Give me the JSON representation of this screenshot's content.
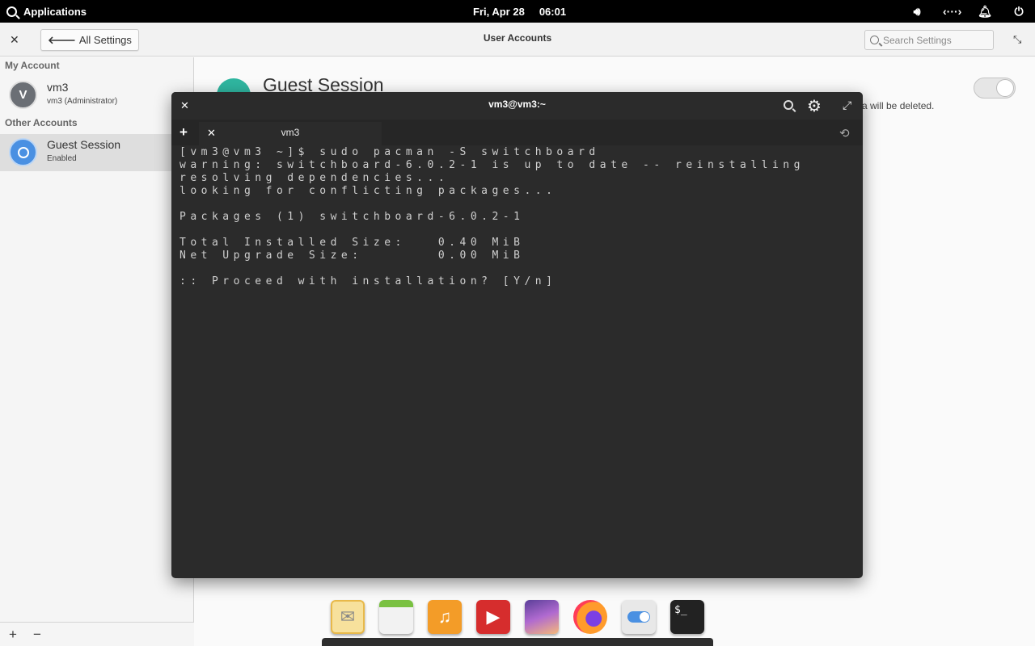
{
  "panel": {
    "applications_label": "Applications",
    "date": "Fri, Apr 28",
    "time": "06:01",
    "icons": [
      "volume-icon",
      "network-icon",
      "notifications-icon",
      "power-icon"
    ]
  },
  "settings": {
    "window_title": "User Accounts",
    "back_label": "All Settings",
    "search_placeholder": "Search Settings"
  },
  "sidebar": {
    "my_account_label": "My Account",
    "other_accounts_label": "Other Accounts",
    "my_account": {
      "initial": "V",
      "name": "vm3",
      "subtitle": "vm3  (Administrator)"
    },
    "other_accounts": [
      {
        "name": "Guest Session",
        "subtitle": "Enabled"
      }
    ],
    "footer": {
      "add": "+",
      "remove": "−"
    }
  },
  "main": {
    "title": "Guest Session",
    "description_visible": "a will be deleted.",
    "guest_enabled": true
  },
  "terminal": {
    "title": "vm3@vm3:~",
    "tab_label": "vm3",
    "lines": [
      "[vm3@vm3 ~]$ sudo pacman -S switchboard",
      "warning: switchboard-6.0.2-1 is up to date -- reinstalling",
      "resolving dependencies...",
      "looking for conflicting packages...",
      "",
      "Packages (1) switchboard-6.0.2-1",
      "",
      "Total Installed Size:   0.40 MiB",
      "Net Upgrade Size:       0.00 MiB",
      "",
      ":: Proceed with installation? [Y/n]"
    ]
  },
  "dock": {
    "items": [
      "mail-app-icon",
      "calendar-app-icon",
      "music-app-icon",
      "videos-app-icon",
      "photos-app-icon",
      "firefox-app-icon",
      "settings-app-icon",
      "terminal-app-icon"
    ],
    "terminal_glyph": "$_"
  }
}
